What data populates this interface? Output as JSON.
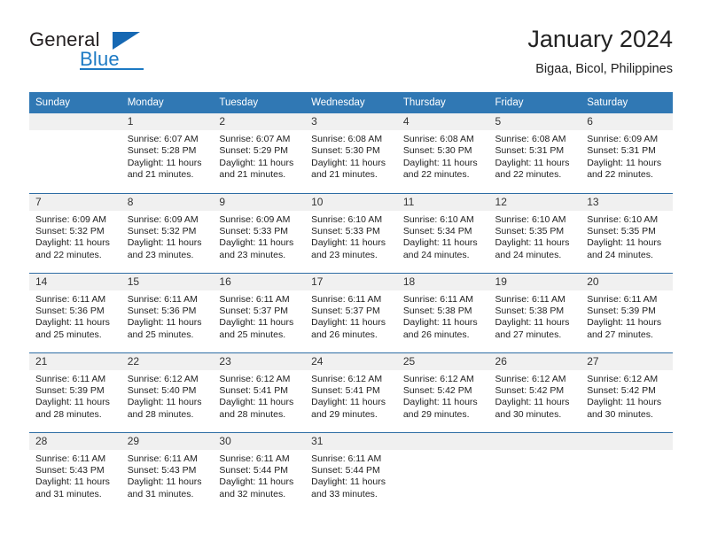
{
  "brand": {
    "name_top": "General",
    "name_bottom": "Blue",
    "accent_color": "#1668b3",
    "text_color": "#231f20"
  },
  "header": {
    "title": "January 2024",
    "subtitle": "Bigaa, Bicol, Philippines"
  },
  "theme": {
    "header_row_color": "#3078b4",
    "week_divider_color": "#2e6da4",
    "daynum_bg": "#f0f0f0"
  },
  "calendar": {
    "weekday_headers": [
      "Sunday",
      "Monday",
      "Tuesday",
      "Wednesday",
      "Thursday",
      "Friday",
      "Saturday"
    ],
    "labels": {
      "sunrise": "Sunrise:",
      "sunset": "Sunset:",
      "daylight": "Daylight:"
    },
    "weeks": [
      [
        {
          "day": "",
          "empty": true,
          "sunrise": "",
          "sunset": "",
          "daylight": ""
        },
        {
          "day": "1",
          "empty": false,
          "sunrise": "Sunrise: 6:07 AM",
          "sunset": "Sunset: 5:28 PM",
          "daylight": "Daylight: 11 hours and 21 minutes."
        },
        {
          "day": "2",
          "empty": false,
          "sunrise": "Sunrise: 6:07 AM",
          "sunset": "Sunset: 5:29 PM",
          "daylight": "Daylight: 11 hours and 21 minutes."
        },
        {
          "day": "3",
          "empty": false,
          "sunrise": "Sunrise: 6:08 AM",
          "sunset": "Sunset: 5:30 PM",
          "daylight": "Daylight: 11 hours and 21 minutes."
        },
        {
          "day": "4",
          "empty": false,
          "sunrise": "Sunrise: 6:08 AM",
          "sunset": "Sunset: 5:30 PM",
          "daylight": "Daylight: 11 hours and 22 minutes."
        },
        {
          "day": "5",
          "empty": false,
          "sunrise": "Sunrise: 6:08 AM",
          "sunset": "Sunset: 5:31 PM",
          "daylight": "Daylight: 11 hours and 22 minutes."
        },
        {
          "day": "6",
          "empty": false,
          "sunrise": "Sunrise: 6:09 AM",
          "sunset": "Sunset: 5:31 PM",
          "daylight": "Daylight: 11 hours and 22 minutes."
        }
      ],
      [
        {
          "day": "7",
          "empty": false,
          "sunrise": "Sunrise: 6:09 AM",
          "sunset": "Sunset: 5:32 PM",
          "daylight": "Daylight: 11 hours and 22 minutes."
        },
        {
          "day": "8",
          "empty": false,
          "sunrise": "Sunrise: 6:09 AM",
          "sunset": "Sunset: 5:32 PM",
          "daylight": "Daylight: 11 hours and 23 minutes."
        },
        {
          "day": "9",
          "empty": false,
          "sunrise": "Sunrise: 6:09 AM",
          "sunset": "Sunset: 5:33 PM",
          "daylight": "Daylight: 11 hours and 23 minutes."
        },
        {
          "day": "10",
          "empty": false,
          "sunrise": "Sunrise: 6:10 AM",
          "sunset": "Sunset: 5:33 PM",
          "daylight": "Daylight: 11 hours and 23 minutes."
        },
        {
          "day": "11",
          "empty": false,
          "sunrise": "Sunrise: 6:10 AM",
          "sunset": "Sunset: 5:34 PM",
          "daylight": "Daylight: 11 hours and 24 minutes."
        },
        {
          "day": "12",
          "empty": false,
          "sunrise": "Sunrise: 6:10 AM",
          "sunset": "Sunset: 5:35 PM",
          "daylight": "Daylight: 11 hours and 24 minutes."
        },
        {
          "day": "13",
          "empty": false,
          "sunrise": "Sunrise: 6:10 AM",
          "sunset": "Sunset: 5:35 PM",
          "daylight": "Daylight: 11 hours and 24 minutes."
        }
      ],
      [
        {
          "day": "14",
          "empty": false,
          "sunrise": "Sunrise: 6:11 AM",
          "sunset": "Sunset: 5:36 PM",
          "daylight": "Daylight: 11 hours and 25 minutes."
        },
        {
          "day": "15",
          "empty": false,
          "sunrise": "Sunrise: 6:11 AM",
          "sunset": "Sunset: 5:36 PM",
          "daylight": "Daylight: 11 hours and 25 minutes."
        },
        {
          "day": "16",
          "empty": false,
          "sunrise": "Sunrise: 6:11 AM",
          "sunset": "Sunset: 5:37 PM",
          "daylight": "Daylight: 11 hours and 25 minutes."
        },
        {
          "day": "17",
          "empty": false,
          "sunrise": "Sunrise: 6:11 AM",
          "sunset": "Sunset: 5:37 PM",
          "daylight": "Daylight: 11 hours and 26 minutes."
        },
        {
          "day": "18",
          "empty": false,
          "sunrise": "Sunrise: 6:11 AM",
          "sunset": "Sunset: 5:38 PM",
          "daylight": "Daylight: 11 hours and 26 minutes."
        },
        {
          "day": "19",
          "empty": false,
          "sunrise": "Sunrise: 6:11 AM",
          "sunset": "Sunset: 5:38 PM",
          "daylight": "Daylight: 11 hours and 27 minutes."
        },
        {
          "day": "20",
          "empty": false,
          "sunrise": "Sunrise: 6:11 AM",
          "sunset": "Sunset: 5:39 PM",
          "daylight": "Daylight: 11 hours and 27 minutes."
        }
      ],
      [
        {
          "day": "21",
          "empty": false,
          "sunrise": "Sunrise: 6:11 AM",
          "sunset": "Sunset: 5:39 PM",
          "daylight": "Daylight: 11 hours and 28 minutes."
        },
        {
          "day": "22",
          "empty": false,
          "sunrise": "Sunrise: 6:12 AM",
          "sunset": "Sunset: 5:40 PM",
          "daylight": "Daylight: 11 hours and 28 minutes."
        },
        {
          "day": "23",
          "empty": false,
          "sunrise": "Sunrise: 6:12 AM",
          "sunset": "Sunset: 5:41 PM",
          "daylight": "Daylight: 11 hours and 28 minutes."
        },
        {
          "day": "24",
          "empty": false,
          "sunrise": "Sunrise: 6:12 AM",
          "sunset": "Sunset: 5:41 PM",
          "daylight": "Daylight: 11 hours and 29 minutes."
        },
        {
          "day": "25",
          "empty": false,
          "sunrise": "Sunrise: 6:12 AM",
          "sunset": "Sunset: 5:42 PM",
          "daylight": "Daylight: 11 hours and 29 minutes."
        },
        {
          "day": "26",
          "empty": false,
          "sunrise": "Sunrise: 6:12 AM",
          "sunset": "Sunset: 5:42 PM",
          "daylight": "Daylight: 11 hours and 30 minutes."
        },
        {
          "day": "27",
          "empty": false,
          "sunrise": "Sunrise: 6:12 AM",
          "sunset": "Sunset: 5:42 PM",
          "daylight": "Daylight: 11 hours and 30 minutes."
        }
      ],
      [
        {
          "day": "28",
          "empty": false,
          "sunrise": "Sunrise: 6:11 AM",
          "sunset": "Sunset: 5:43 PM",
          "daylight": "Daylight: 11 hours and 31 minutes."
        },
        {
          "day": "29",
          "empty": false,
          "sunrise": "Sunrise: 6:11 AM",
          "sunset": "Sunset: 5:43 PM",
          "daylight": "Daylight: 11 hours and 31 minutes."
        },
        {
          "day": "30",
          "empty": false,
          "sunrise": "Sunrise: 6:11 AM",
          "sunset": "Sunset: 5:44 PM",
          "daylight": "Daylight: 11 hours and 32 minutes."
        },
        {
          "day": "31",
          "empty": false,
          "sunrise": "Sunrise: 6:11 AM",
          "sunset": "Sunset: 5:44 PM",
          "daylight": "Daylight: 11 hours and 33 minutes."
        },
        {
          "day": "",
          "empty": true,
          "sunrise": "",
          "sunset": "",
          "daylight": ""
        },
        {
          "day": "",
          "empty": true,
          "sunrise": "",
          "sunset": "",
          "daylight": ""
        },
        {
          "day": "",
          "empty": true,
          "sunrise": "",
          "sunset": "",
          "daylight": ""
        }
      ]
    ]
  }
}
